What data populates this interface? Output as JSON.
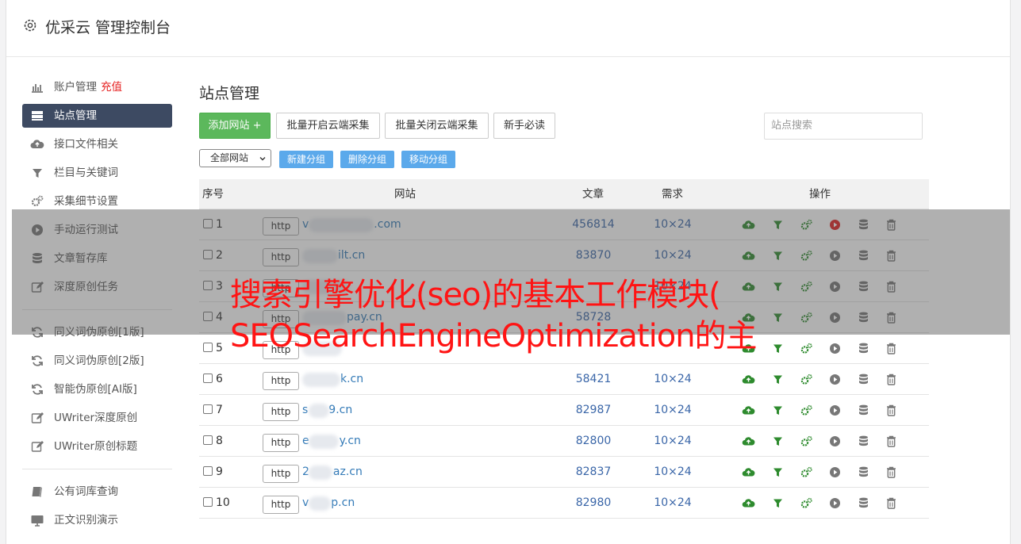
{
  "app": {
    "title": "优采云 管理控制台"
  },
  "sidebar": {
    "group1": [
      {
        "label": "账户管理",
        "extra": "充值",
        "icon": "bar-chart-icon"
      },
      {
        "label": "站点管理",
        "icon": "server-icon",
        "active": true
      },
      {
        "label": "接口文件相关",
        "icon": "cloud-upload-icon"
      },
      {
        "label": "栏目与关键词",
        "icon": "filter-icon"
      },
      {
        "label": "采集细节设置",
        "icon": "cogs-icon"
      },
      {
        "label": "手动运行测试",
        "icon": "play-circle-icon"
      },
      {
        "label": "文章暂存库",
        "icon": "database-icon"
      },
      {
        "label": "深度原创任务",
        "icon": "edit-icon"
      }
    ],
    "group2": [
      {
        "label": "同义词伪原创[1版]",
        "icon": "refresh-icon"
      },
      {
        "label": "同义词伪原创[2版]",
        "icon": "refresh-icon"
      },
      {
        "label": "智能伪原创[AI版]",
        "icon": "refresh-icon"
      },
      {
        "label": "UWriter深度原创",
        "icon": "edit-icon"
      },
      {
        "label": "UWriter原创标题",
        "icon": "edit-icon"
      }
    ],
    "group3": [
      {
        "label": "公有词库查询",
        "icon": "book-icon"
      },
      {
        "label": "正文识别演示",
        "icon": "monitor-icon"
      }
    ]
  },
  "main": {
    "page_title": "站点管理",
    "toolbar": {
      "add_site": "添加网站 +",
      "batch_enable": "批量开启云端采集",
      "batch_disable": "批量关闭云端采集",
      "beginner": "新手必读",
      "search_placeholder": "站点搜索"
    },
    "filter": {
      "group_select": "全部网站",
      "new_group": "新建分组",
      "delete_group": "删除分组",
      "move_group": "移动分组"
    },
    "table": {
      "headers": {
        "index": "序号",
        "site": "网站",
        "articles": "文章",
        "demand": "需求",
        "actions": "操作"
      },
      "rows": [
        {
          "index": "1",
          "protocol": "http",
          "site_prefix": "v",
          "site_suffix": ".com",
          "articles": "456814",
          "demand": "10×24",
          "run_active": true
        },
        {
          "index": "2",
          "protocol": "http",
          "site_prefix": "",
          "site_suffix": "ilt.cn",
          "articles": "83870",
          "demand": "10×24",
          "run_active": false
        },
        {
          "index": "3",
          "protocol": "http",
          "site_prefix": "",
          "site_suffix": "",
          "articles": "",
          "demand": "10×24",
          "run_active": false
        },
        {
          "index": "4",
          "protocol": "http",
          "site_prefix": "",
          "site_suffix": "pay.cn",
          "articles": "58728",
          "demand": "",
          "run_active": false
        },
        {
          "index": "5",
          "protocol": "http",
          "site_prefix": "",
          "site_suffix": "",
          "articles": "",
          "demand": "",
          "run_active": false
        },
        {
          "index": "6",
          "protocol": "http",
          "site_prefix": "",
          "site_suffix": "k.cn",
          "articles": "58421",
          "demand": "10×24",
          "run_active": false
        },
        {
          "index": "7",
          "protocol": "http",
          "site_prefix": "s",
          "site_suffix": "9.cn",
          "articles": "82987",
          "demand": "10×24",
          "run_active": false
        },
        {
          "index": "8",
          "protocol": "http",
          "site_prefix": "e",
          "site_suffix": "y.cn",
          "articles": "82800",
          "demand": "10×24",
          "run_active": false
        },
        {
          "index": "9",
          "protocol": "http",
          "site_prefix": "2",
          "site_suffix": "az.cn",
          "articles": "82837",
          "demand": "10×24",
          "run_active": false
        },
        {
          "index": "10",
          "protocol": "http",
          "site_prefix": "v",
          "site_suffix": "p.cn",
          "articles": "82980",
          "demand": "10×24",
          "run_active": false
        }
      ]
    }
  },
  "overlay": {
    "line1": "搜索引擎优化(seo)的基本工作模块(",
    "line2": "SEOSearchEngineOptimization的主"
  },
  "colors": {
    "sidebar_active": "#3d4a62",
    "green_button": "#5cb85c",
    "blue_small_button": "#5ba9eb",
    "link_blue": "#337ab7",
    "overlay_text": "#ff1414",
    "action_green": "#2e8b2e",
    "run_red": "#e02020"
  }
}
